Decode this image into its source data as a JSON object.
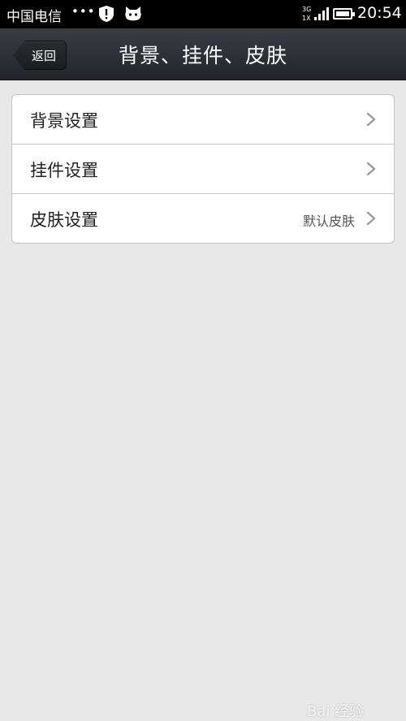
{
  "status_bar": {
    "carrier": "中国电信",
    "dots": "•••",
    "net_top": "3G",
    "net_bottom": "1X",
    "battery_level": 0.8,
    "time": "20:54"
  },
  "header": {
    "back_label": "返回",
    "title": "背景、挂件、皮肤"
  },
  "settings": {
    "items": [
      {
        "label": "背景设置",
        "value": ""
      },
      {
        "label": "挂件设置",
        "value": ""
      },
      {
        "label": "皮肤设置",
        "value": "默认皮肤"
      }
    ]
  },
  "watermark": {
    "text": "Bai 经验"
  },
  "colors": {
    "header_bg": "#2b2e33",
    "page_bg": "#e8e8e8",
    "card_bg": "#ffffff"
  }
}
